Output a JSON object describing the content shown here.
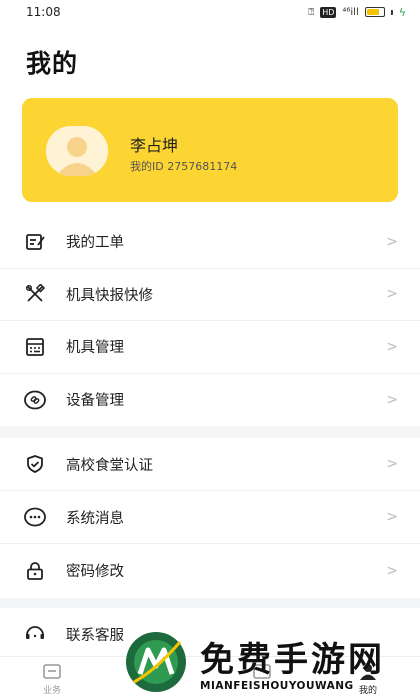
{
  "status_bar": {
    "time": "11:08",
    "signal_text": "⁴⁶ill",
    "hd": "HD",
    "battery_level": 0.7
  },
  "page": {
    "title": "我的"
  },
  "profile": {
    "name": "李占坤",
    "id_label": "我的ID 2757681174"
  },
  "menu_groups": [
    [
      {
        "label": "我的工单",
        "icon": "edit-note-icon"
      },
      {
        "label": "机具快报快修",
        "icon": "tools-icon"
      },
      {
        "label": "机具管理",
        "icon": "calculator-icon"
      },
      {
        "label": "设备管理",
        "icon": "link-icon"
      }
    ],
    [
      {
        "label": "高校食堂认证",
        "icon": "shield-check-icon"
      },
      {
        "label": "系统消息",
        "icon": "message-icon"
      },
      {
        "label": "密码修改",
        "icon": "lock-icon"
      }
    ],
    [
      {
        "label": "联系客服",
        "icon": "headset-icon"
      }
    ]
  ],
  "tabbar": {
    "business": "业务",
    "middle": "",
    "mine": "我的"
  },
  "watermark": {
    "title": "免费手游网",
    "subtitle": "MIANFEISHOUYOUWANG"
  },
  "colors": {
    "accent": "#fcd533",
    "text": "#222222"
  }
}
